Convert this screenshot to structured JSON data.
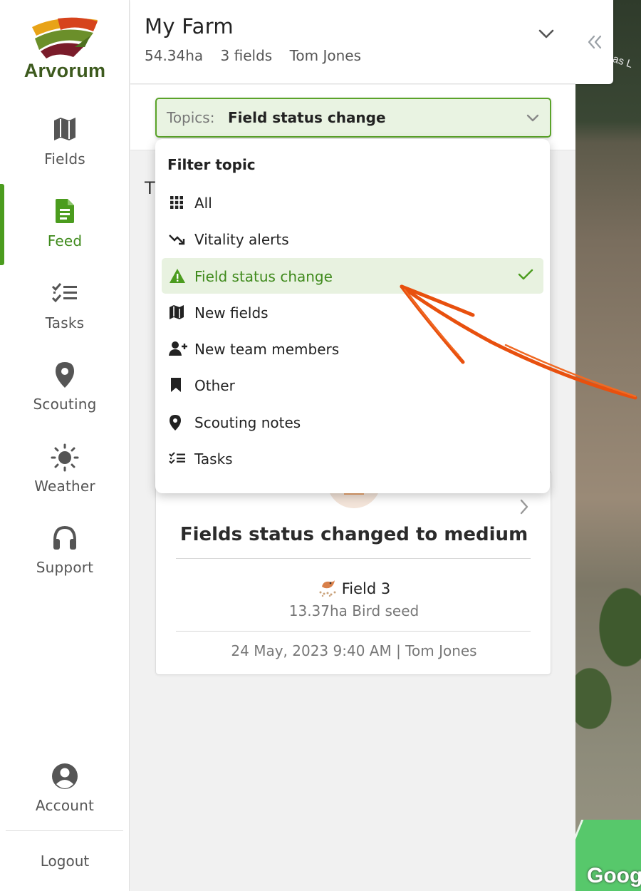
{
  "brand": {
    "name": "Arvorum"
  },
  "nav": {
    "fields": "Fields",
    "feed": "Feed",
    "tasks": "Tasks",
    "scouting": "Scouting",
    "weather": "Weather",
    "support": "Support",
    "account": "Account",
    "logout": "Logout"
  },
  "header": {
    "title": "My Farm",
    "area": "54.34ha",
    "fields": "3 fields",
    "owner": "Tom Jones"
  },
  "filter": {
    "prefix": "Topics:",
    "selected": "Field status change"
  },
  "dropdown": {
    "title": "Filter topic",
    "items": [
      {
        "label": "All",
        "icon": "grid-icon"
      },
      {
        "label": "Vitality alerts",
        "icon": "trend-down-icon"
      },
      {
        "label": "Field status change",
        "icon": "warning-icon",
        "selected": true
      },
      {
        "label": "New fields",
        "icon": "map-icon"
      },
      {
        "label": "New team members",
        "icon": "user-add-icon"
      },
      {
        "label": "Other",
        "icon": "bookmark-icon"
      },
      {
        "label": "Scouting notes",
        "icon": "pin-icon"
      },
      {
        "label": "Tasks",
        "icon": "checklist-icon"
      }
    ]
  },
  "feed": {
    "partial_heading": "T",
    "card": {
      "title": "Fields status changed to medium",
      "field_name": "Field 3",
      "field_detail": "13.37ha Bird seed",
      "footer": "24 May, 2023 9:40 AM | Tom Jones"
    }
  },
  "map": {
    "road_label": "as L",
    "attribution": "Goog"
  },
  "colors": {
    "accent": "#4b9c1e",
    "selected_bg": "#e8f2e0",
    "annotation": "#e8500e"
  }
}
